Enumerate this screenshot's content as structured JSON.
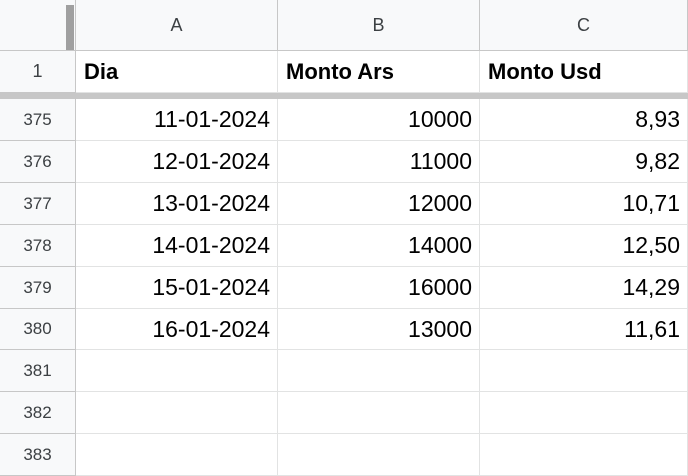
{
  "sheet": {
    "columns": [
      "A",
      "B",
      "C"
    ],
    "header_row": {
      "number": "1",
      "cells": [
        "Dia",
        "Monto Ars",
        "Monto Usd"
      ]
    },
    "rows": [
      {
        "number": "375",
        "cells": [
          "11-01-2024",
          "10000",
          "8,93"
        ]
      },
      {
        "number": "376",
        "cells": [
          "12-01-2024",
          "11000",
          "9,82"
        ]
      },
      {
        "number": "377",
        "cells": [
          "13-01-2024",
          "12000",
          "10,71"
        ]
      },
      {
        "number": "378",
        "cells": [
          "14-01-2024",
          "14000",
          "12,50"
        ]
      },
      {
        "number": "379",
        "cells": [
          "15-01-2024",
          "16000",
          "14,29"
        ]
      },
      {
        "number": "380",
        "cells": [
          "16-01-2024",
          "13000",
          "11,61"
        ]
      },
      {
        "number": "381",
        "cells": [
          "",
          "",
          ""
        ]
      },
      {
        "number": "382",
        "cells": [
          "",
          "",
          ""
        ]
      },
      {
        "number": "383",
        "cells": [
          "",
          "",
          ""
        ]
      }
    ]
  }
}
